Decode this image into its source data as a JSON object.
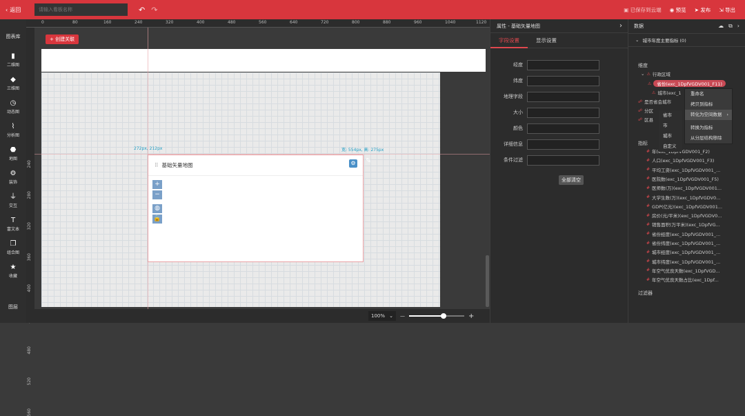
{
  "topbar": {
    "back_label": "返回",
    "title_placeholder": "请输入看板名称",
    "saved": "已保存到云端",
    "preview": "预览",
    "publish": "发布",
    "export": "导出"
  },
  "left_toolbar": {
    "library": "图表库",
    "items": [
      {
        "label": "二维图",
        "icon": "bar-chart-icon"
      },
      {
        "label": "三维图",
        "icon": "cube-icon"
      },
      {
        "label": "动态图",
        "icon": "clock-icon"
      },
      {
        "label": "分析图",
        "icon": "line-chart-icon"
      },
      {
        "label": "地图",
        "icon": "map-pin-icon"
      },
      {
        "label": "装饰",
        "icon": "gear-icon"
      },
      {
        "label": "交互",
        "icon": "filter-icon"
      },
      {
        "label": "富文本",
        "icon": "text-icon"
      },
      {
        "label": "组合图",
        "icon": "combo-icon"
      },
      {
        "label": "收藏",
        "icon": "star-icon"
      }
    ],
    "layers": "图层"
  },
  "ruler": {
    "top_ticks": [
      "0",
      "80",
      "160",
      "240",
      "320",
      "400",
      "480",
      "560",
      "640",
      "720",
      "800",
      "880",
      "960",
      "1040",
      "1120"
    ],
    "left_ticks": [
      "240",
      "280",
      "320",
      "360",
      "400",
      "440",
      "480",
      "520",
      "560"
    ]
  },
  "canvas": {
    "create_link": "+ 创建关联",
    "coord_left": "272px, 212px",
    "coord_right": "宽: 554px, 高: 275px",
    "widget_title": "基础矢量地图",
    "zoom": "100%"
  },
  "props": {
    "header": "属性 - 基础矢量地图",
    "tabs": [
      "字段设置",
      "显示设置"
    ],
    "fields": [
      "经度",
      "纬度",
      "地理字段",
      "大小",
      "颜色",
      "详细信息",
      "条件过滤"
    ],
    "clear_all": "全部清空"
  },
  "data_panel": {
    "header": "数据",
    "dataset": "城市年度主要指标 (0)",
    "dimension_label": "维度",
    "group": "行政区域",
    "dims": [
      "省份(exc_1DpfVGDV001_F11)",
      "城市(exc_1",
      "是否省会城市",
      "分区",
      "区县"
    ],
    "context_menu": [
      "重命名",
      "拷贝到指标",
      "转化为空间数据",
      "转换为指标",
      "从分层结构移除"
    ],
    "submenu": [
      "省市",
      "市",
      "城市",
      "自定义"
    ],
    "measure_label": "指标",
    "measures": [
      "年(exc_1DpfVGDV001_F2)",
      "人口(exc_1DpfVGDV001_F3)",
      "平均工资(exc_1DpfVGDV001_...",
      "医院数(exc_1DpfVGDV001_F5)",
      "医师数(万)(exc_1DpfVGDV001...",
      "大学生数(万)(exc_1DpfVGDV0...",
      "GDP(亿元)(exc_1DpfVGDV001...",
      "房价(元/平米)(exc_1DpfVGDV0...",
      "销售面积(万平米)(exc_1DpfVG...",
      "省份经度(exc_1DpfVGDV001_...",
      "省份纬度(exc_1DpfVGDV001_...",
      "城市经度(exc_1DpfVGDV001_...",
      "城市纬度(exc_1DpfVGDV001_...",
      "年空气优良天数(exc_1DpfVGD...",
      "年空气优良天数占比(exc_1Dpf..."
    ],
    "filter_label": "过滤器"
  }
}
